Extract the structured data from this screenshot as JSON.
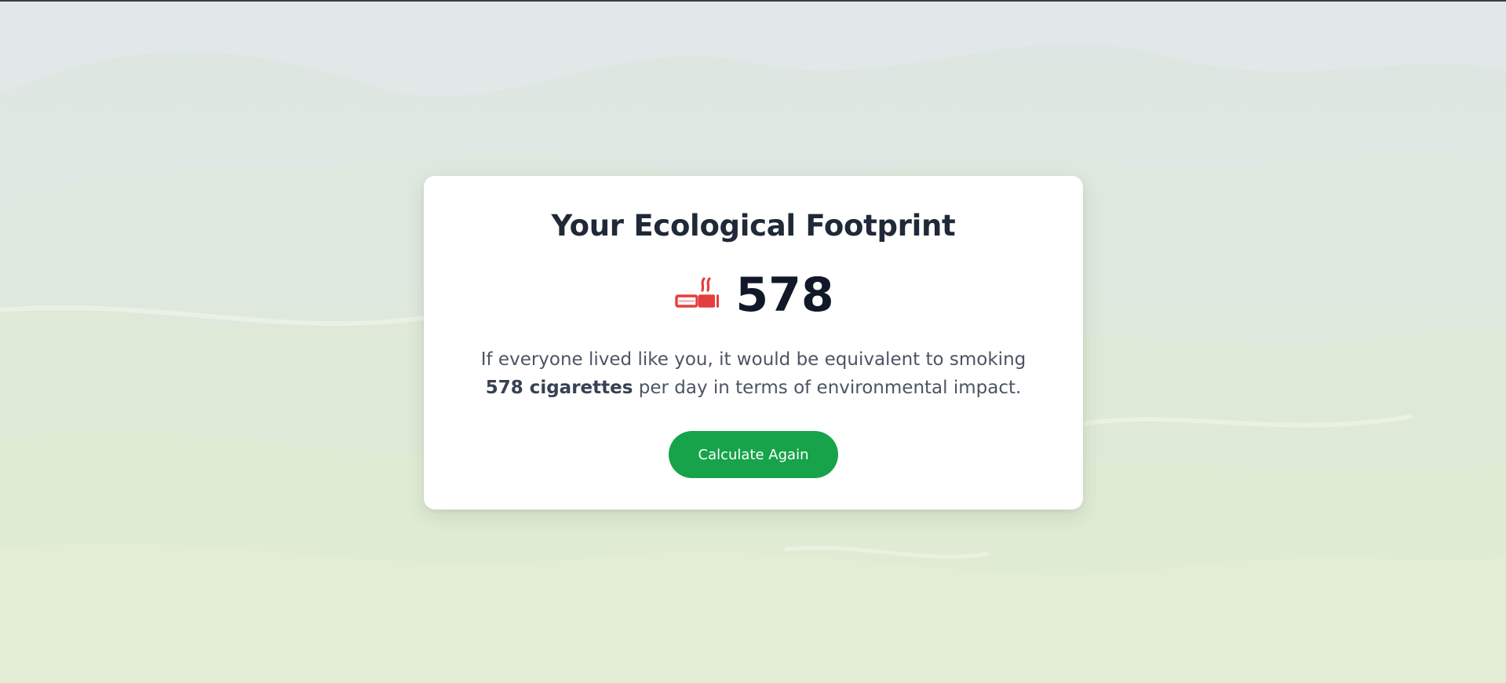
{
  "result": {
    "title": "Your Ecological Footprint",
    "score": "578",
    "icon": "smoking-cigarette-icon",
    "description_prefix": "If everyone lived like you, it would be equivalent to smoking ",
    "description_highlight": "578 cigarettes",
    "description_suffix": " per day in terms of environmental impact.",
    "button_label": "Calculate Again"
  },
  "colors": {
    "accent": "#17a34a",
    "icon": "#e53e3e",
    "title": "#1f2937",
    "text": "#4b5563",
    "card": "#ffffff"
  }
}
